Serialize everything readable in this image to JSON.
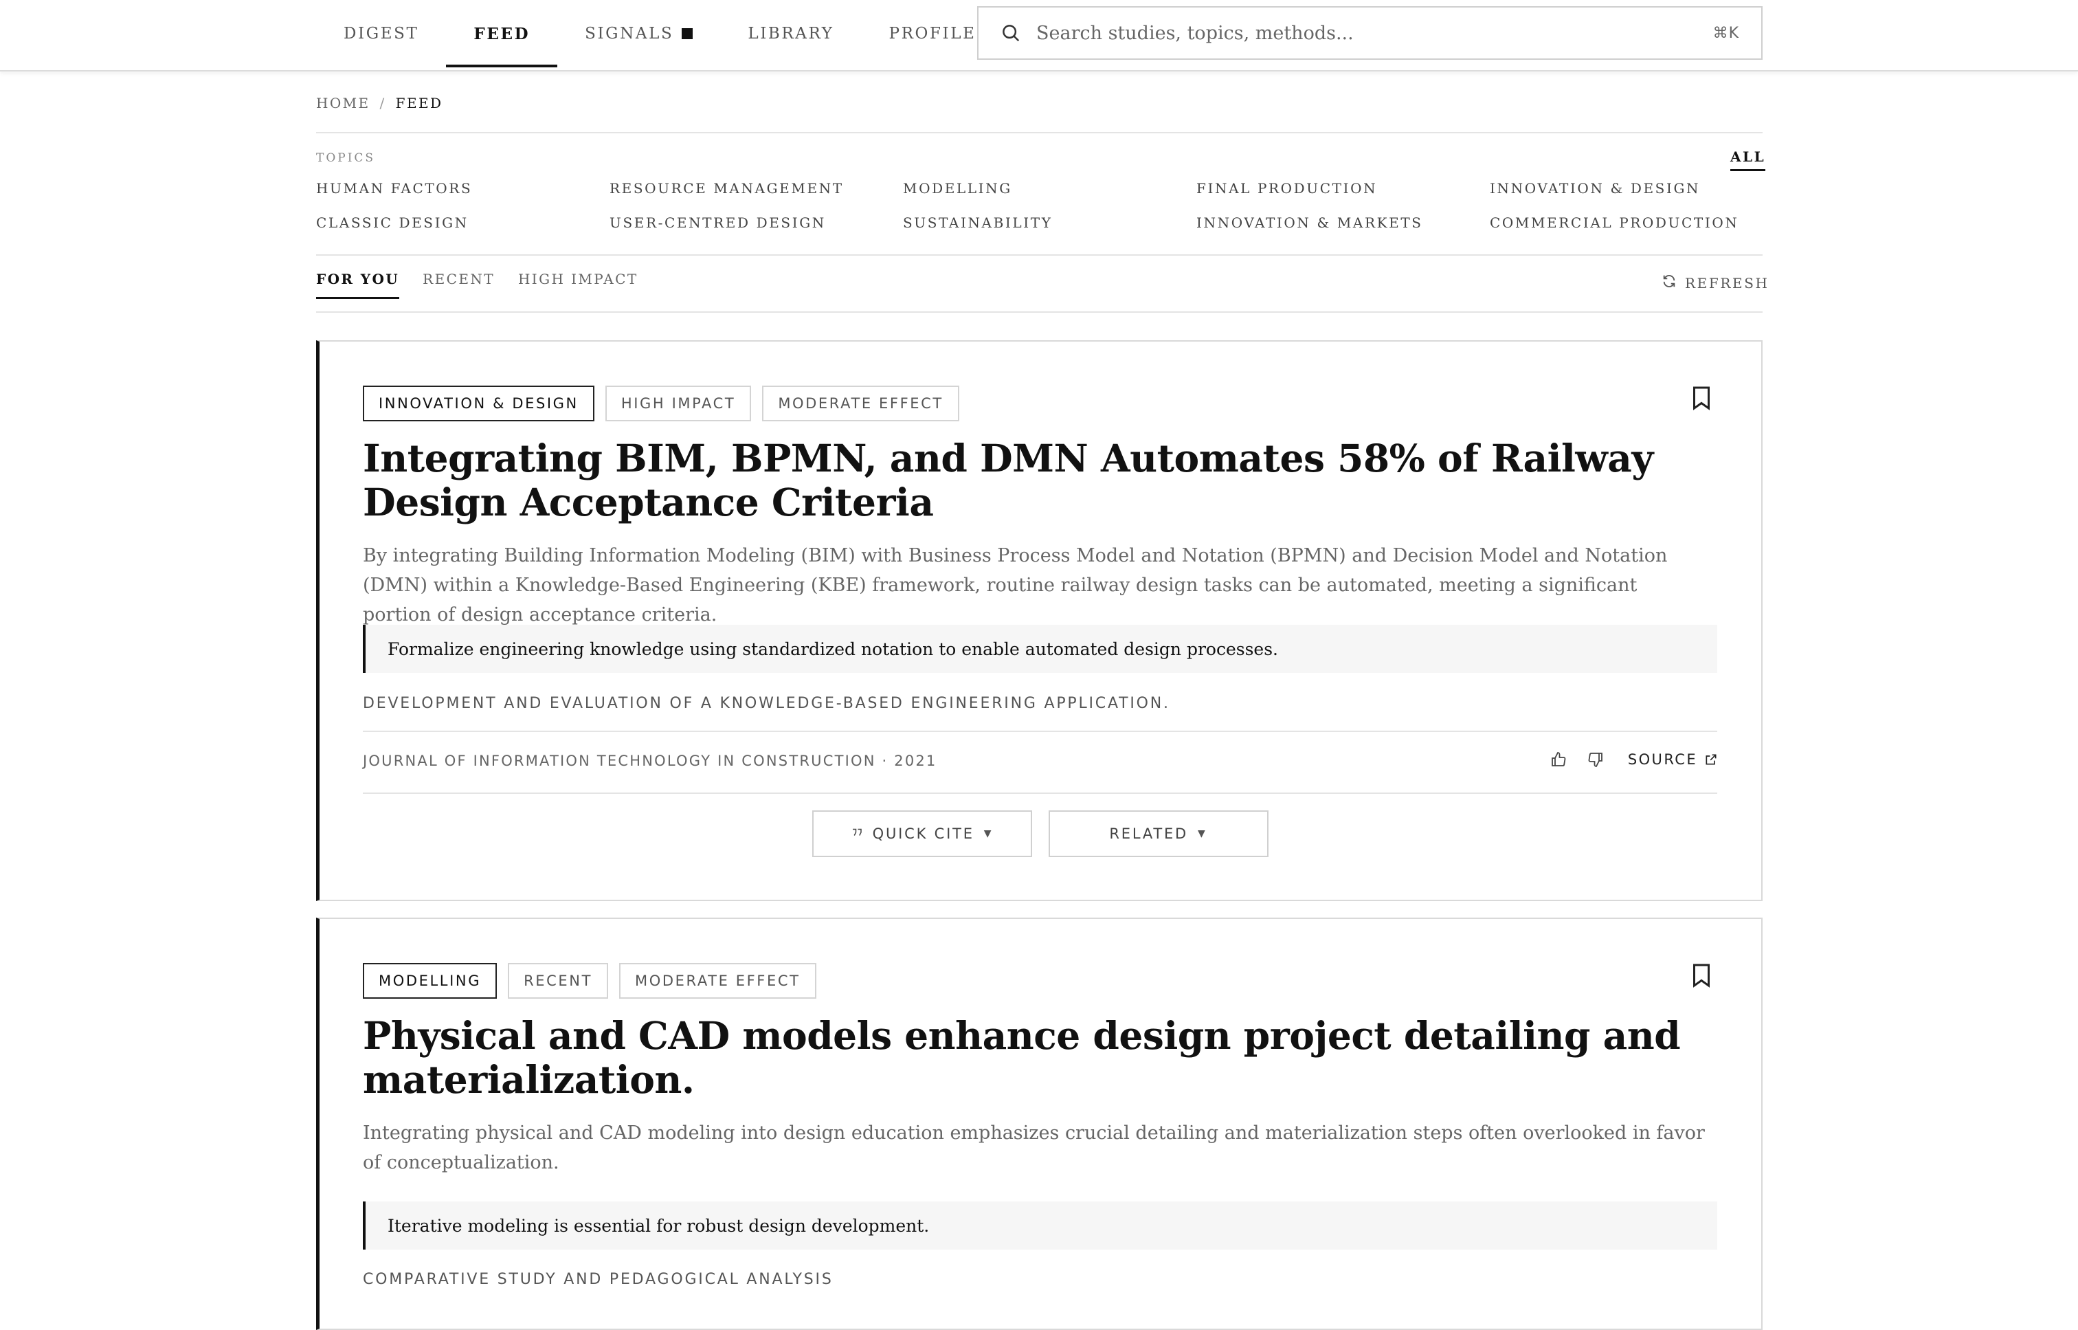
{
  "nav": {
    "items": [
      {
        "label": "DIGEST",
        "active": false
      },
      {
        "label": "FEED",
        "active": true
      },
      {
        "label": "SIGNALS",
        "active": false
      },
      {
        "label": "LIBRARY",
        "active": false
      },
      {
        "label": "PROFILE",
        "active": false
      }
    ]
  },
  "search": {
    "placeholder": "Search studies, topics, methods...",
    "value": "",
    "shortcut": "⌘K"
  },
  "breadcrumb": {
    "home": "HOME",
    "separator": "/",
    "current": "FEED"
  },
  "topics": {
    "label": "TOPICS",
    "all": "ALL",
    "items": [
      "HUMAN FACTORS",
      "RESOURCE MANAGEMENT",
      "MODELLING",
      "FINAL PRODUCTION",
      "INNOVATION & DESIGN",
      "CLASSIC DESIGN",
      "USER-CENTRED DESIGN",
      "SUSTAINABILITY",
      "INNOVATION & MARKETS",
      "COMMERCIAL PRODUCTION"
    ]
  },
  "feed_tabs": {
    "items": [
      {
        "label": "FOR YOU",
        "active": true
      },
      {
        "label": "RECENT",
        "active": false
      },
      {
        "label": "HIGH IMPACT",
        "active": false
      }
    ],
    "refresh": "REFRESH"
  },
  "cards": [
    {
      "tags": [
        "INNOVATION & DESIGN",
        "HIGH IMPACT",
        "MODERATE EFFECT"
      ],
      "title": "Integrating BIM, BPMN, and DMN Automates 58% of Railway Design Acceptance Criteria",
      "summary": "By integrating Building Information Modeling (BIM) with Business Process Model and Notation (BPMN) and Decision Model and Notation (DMN) within a Knowledge-Based Engineering (KBE) framework, routine railway design tasks can be automated, meeting a significant portion of design acceptance criteria.",
      "insight": "Formalize engineering knowledge using standardized notation to enable automated design processes.",
      "method": "DEVELOPMENT AND EVALUATION OF A KNOWLEDGE-BASED ENGINEERING APPLICATION.",
      "meta": "JOURNAL OF INFORMATION TECHNOLOGY IN CONSTRUCTION · 2021",
      "source": "SOURCE",
      "quick_cite": "QUICK CITE",
      "related": "RELATED"
    },
    {
      "tags": [
        "MODELLING",
        "RECENT",
        "MODERATE EFFECT"
      ],
      "title": "Physical and CAD models enhance design project detailing and materialization.",
      "summary": "Integrating physical and CAD modeling into design education emphasizes crucial detailing and materialization steps often overlooked in favor of conceptualization.",
      "insight": "Iterative modeling is essential for robust design development.",
      "method": "COMPARATIVE STUDY AND PEDAGOGICAL ANALYSIS"
    }
  ],
  "icons": {
    "search": "search-icon",
    "refresh": "refresh-icon",
    "bookmark": "bookmark-icon",
    "thumbs_up": "thumbs-up-icon",
    "thumbs_down": "thumbs-down-icon",
    "external": "external-link-icon",
    "quote": "quote-icon",
    "chevron": "chevron-down-icon"
  }
}
